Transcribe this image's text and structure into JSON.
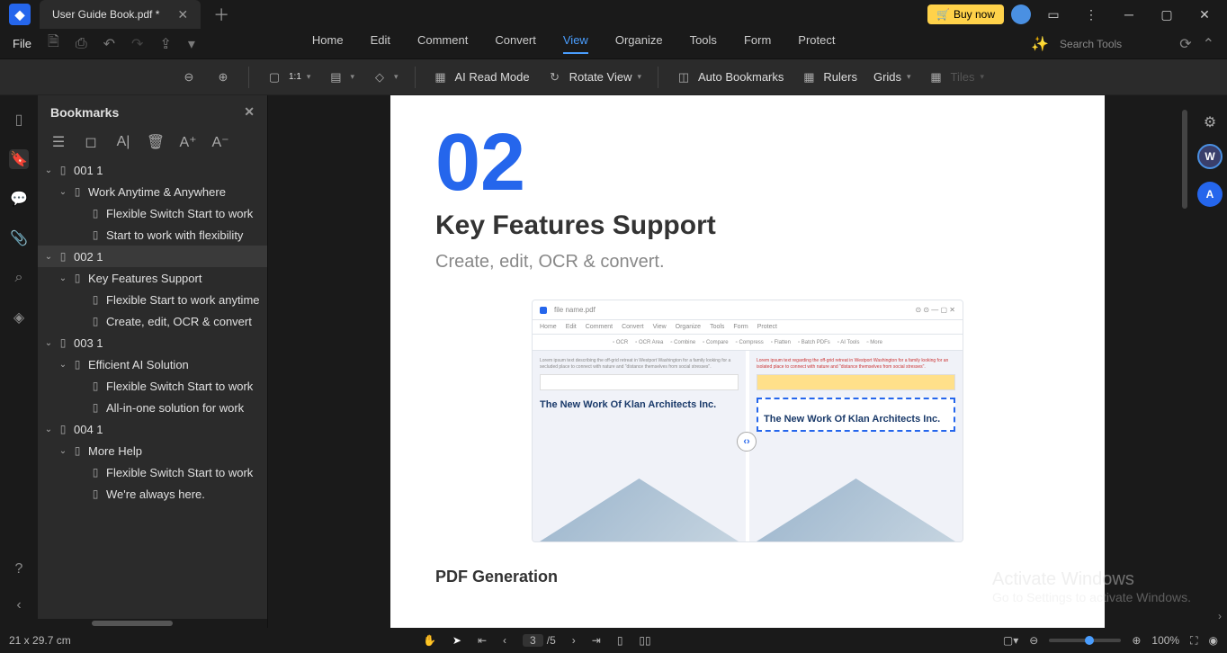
{
  "titlebar": {
    "document_name": "User Guide Book.pdf *",
    "buy_label": "Buy now"
  },
  "menubar": {
    "file": "File",
    "menus": [
      "Home",
      "Edit",
      "Comment",
      "Convert",
      "View",
      "Organize",
      "Tools",
      "Form",
      "Protect"
    ],
    "active_menu": "View",
    "search_placeholder": "Search Tools"
  },
  "ribbon": {
    "ai_read": "AI Read Mode",
    "rotate": "Rotate View",
    "auto_bm": "Auto Bookmarks",
    "rulers": "Rulers",
    "grids": "Grids",
    "tiles": "Tiles",
    "fit_mode": "1:1"
  },
  "panel": {
    "title": "Bookmarks",
    "tree": [
      {
        "lvl": 0,
        "chev": "v",
        "label": "001 1"
      },
      {
        "lvl": 1,
        "chev": "v",
        "label": "Work Anytime & Anywhere"
      },
      {
        "lvl": 2,
        "chev": "",
        "label": "Flexible Switch Start to work"
      },
      {
        "lvl": 2,
        "chev": "",
        "label": "Start to work with flexibility"
      },
      {
        "lvl": 0,
        "chev": "v",
        "label": "002 1",
        "selected": true
      },
      {
        "lvl": 1,
        "chev": "v",
        "label": "Key Features Support"
      },
      {
        "lvl": 2,
        "chev": "",
        "label": "Flexible Start to work anytime"
      },
      {
        "lvl": 2,
        "chev": "",
        "label": "Create, edit, OCR & convert"
      },
      {
        "lvl": 0,
        "chev": "v",
        "label": "003 1"
      },
      {
        "lvl": 1,
        "chev": "v",
        "label": "Efficient AI Solution"
      },
      {
        "lvl": 2,
        "chev": "",
        "label": "Flexible Switch Start to work"
      },
      {
        "lvl": 2,
        "chev": "",
        "label": "All-in-one solution for work"
      },
      {
        "lvl": 0,
        "chev": "v",
        "label": "004 1"
      },
      {
        "lvl": 1,
        "chev": "v",
        "label": "More Help"
      },
      {
        "lvl": 2,
        "chev": "",
        "label": "Flexible Switch Start to work"
      },
      {
        "lvl": 2,
        "chev": "",
        "label": "We're always here."
      }
    ]
  },
  "page": {
    "number": "02",
    "heading": "Key Features Support",
    "subhead": "Create, edit, OCR & convert.",
    "mini_filename": "file name.pdf",
    "mini_menus": [
      "Home",
      "Edit",
      "Comment",
      "Convert",
      "View",
      "Organize",
      "Tools",
      "Form",
      "Protect"
    ],
    "mini_tools": [
      "OCR",
      "OCR Area",
      "Combine",
      "Compare",
      "Compress",
      "Flatten",
      "Batch PDFs",
      "AI Tools",
      "More"
    ],
    "mini_title_a": "The New Work Of Klan Architects Inc.",
    "mini_title_b": "The New Work Of Klan Architects Inc.",
    "section2": "PDF Generation"
  },
  "rside": {
    "w": "W",
    "a": "A"
  },
  "watermark": {
    "title": "Activate Windows",
    "sub": "Go to Settings to activate Windows."
  },
  "statusbar": {
    "dims": "21 x 29.7 cm",
    "page_current": "3",
    "page_total": "/5",
    "zoom": "100%"
  }
}
